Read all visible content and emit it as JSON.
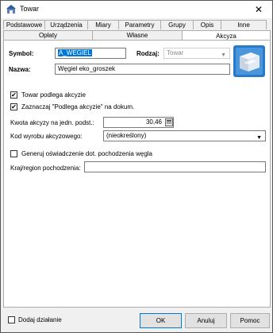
{
  "window": {
    "title": "Towar",
    "close_glyph": "✕"
  },
  "tabs_row1": [
    {
      "label": "Podstawowe"
    },
    {
      "label": "Urządzenia"
    },
    {
      "label": "Miary"
    },
    {
      "label": "Parametry"
    },
    {
      "label": "Grupy"
    },
    {
      "label": "Opis"
    },
    {
      "label": "Inne"
    }
  ],
  "tabs_row2": [
    {
      "label": "Opłaty"
    },
    {
      "label": "Własne"
    },
    {
      "label": "Akcyza",
      "active": true
    }
  ],
  "form": {
    "symbol_label": "Symbol:",
    "symbol_value": "A_WEGIEL",
    "rodzaj_label": "Rodzaj:",
    "rodzaj_value": "Towar",
    "nazwa_label": "Nazwa:",
    "nazwa_value": "Węgiel eko_groszek"
  },
  "akcyza": {
    "podlega_label": "Towar podlega akcyzie",
    "podlega_checked": true,
    "zaznaczaj_label": "Zaznaczaj \"Podlega akcyzie\" na dokum.",
    "zaznaczaj_checked": true,
    "kwota_label": "Kwota akcyzy na jedn. podst.:",
    "kwota_value": "30,46",
    "kod_label": "Kod wyrobu akcyzowego:",
    "kod_value": "(nieokreślony)",
    "generuj_label": "Generuj oświadczenie dot. pochodzenia węgla",
    "generuj_checked": false,
    "kraj_label": "Kraj/region pochodzenia:",
    "kraj_value": ""
  },
  "footer": {
    "dodaj_label": "Dodaj działanie",
    "dodaj_checked": false,
    "ok_label": "OK",
    "anuluj_label": "Anuluj",
    "pomoc_label": "Pomoc"
  },
  "colors": {
    "accent": "#0078d7",
    "panel_bg": "#ffffff",
    "window_bg": "#f0f0f0"
  }
}
